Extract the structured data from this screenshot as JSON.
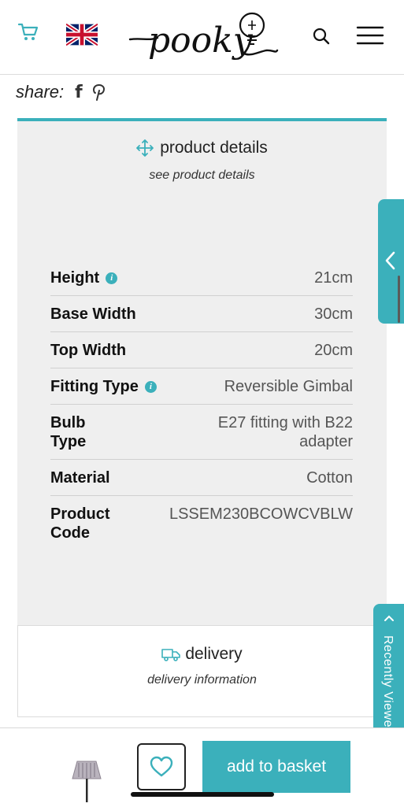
{
  "header": {
    "logo_text": "pooky",
    "icons": [
      "cart-icon",
      "uk-flag-icon",
      "search-icon",
      "menu-icon"
    ],
    "accent_color": "#3bb0bb"
  },
  "share": {
    "label": "share:",
    "icons": [
      "facebook-icon",
      "pinterest-icon"
    ]
  },
  "product_details": {
    "title": "product details",
    "subtitle": "see product details",
    "specs": [
      {
        "label": "Height",
        "value": "21cm",
        "info": true
      },
      {
        "label": "Base Width",
        "value": "30cm",
        "info": false
      },
      {
        "label": "Top Width",
        "value": "20cm",
        "info": false
      },
      {
        "label": "Fitting Type",
        "value": "Reversible Gimbal",
        "info": true
      },
      {
        "label": "Bulb Type",
        "value": "E27 fitting with B22 adapter",
        "info": false
      },
      {
        "label": "Material",
        "value": "Cotton",
        "info": false
      },
      {
        "label": "Product Code",
        "value": "LSSEM230BCOWCVBLW",
        "info": false
      }
    ]
  },
  "delivery": {
    "title": "delivery",
    "subtitle": "delivery information"
  },
  "recently_viewed": {
    "label": "Recently Viewed"
  },
  "bottom_bar": {
    "add_label": "add to basket"
  }
}
